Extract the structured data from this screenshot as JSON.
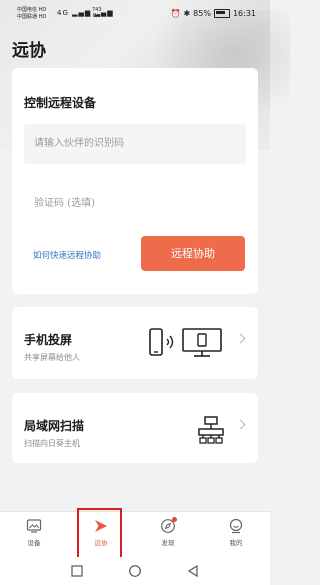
{
  "status_bar": {
    "carrier1": "中国电信 HD",
    "carrier2": "中国联通 HD",
    "network": "4G",
    "speed_value": "743",
    "speed_unit": "B/s",
    "battery": "85%",
    "time": "16:31"
  },
  "page": {
    "title": "远协"
  },
  "connect": {
    "title": "控制远程设备",
    "id_placeholder": "请输入伙伴的识别码",
    "code_placeholder": "验证码 (选填)",
    "help_link": "如何快速远程协助",
    "button": "远程协助"
  },
  "features": [
    {
      "title": "手机投屏",
      "subtitle": "共享屏幕给他人"
    },
    {
      "title": "局域网扫描",
      "subtitle": "扫描向日葵主机"
    }
  ],
  "bottom_nav": {
    "items": [
      {
        "label": "设备",
        "icon": "devices-icon"
      },
      {
        "label": "远协",
        "icon": "remote-assist-icon",
        "active": true
      },
      {
        "label": "发现",
        "icon": "discover-compass-icon"
      },
      {
        "label": "我的",
        "icon": "profile-icon"
      }
    ]
  },
  "colors": {
    "accent": "#ee6c4b",
    "link": "#3a73c6",
    "highlight": "#d62020"
  }
}
